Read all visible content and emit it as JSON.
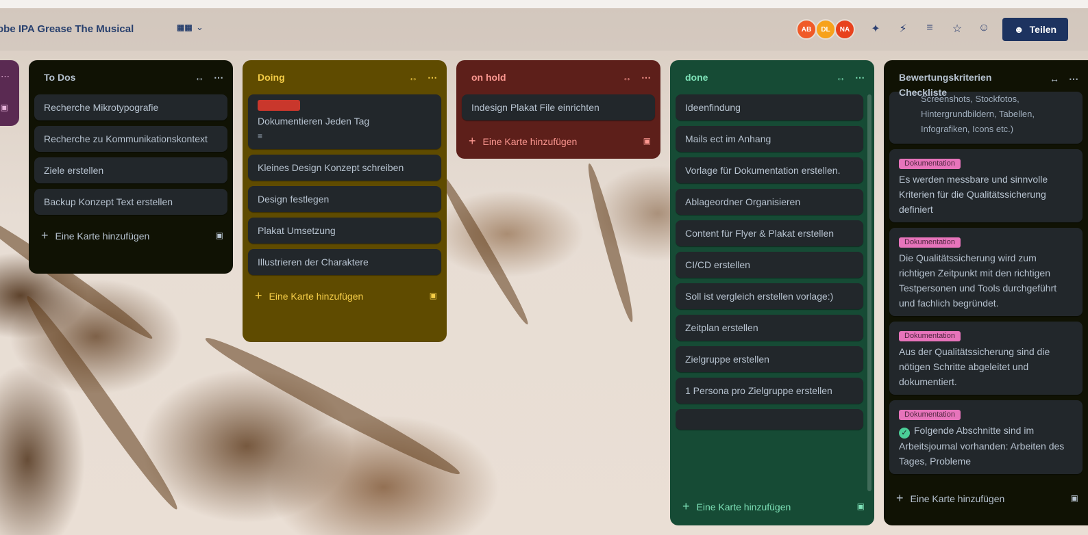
{
  "header": {
    "board_title": "obe IPA Grease The Musical",
    "board_view_icon": "board-icon",
    "share_label": "Teilen",
    "avatars": [
      {
        "initials": "AB",
        "color": "#f05a28"
      },
      {
        "initials": "DL",
        "color": "#f7a21b"
      },
      {
        "initials": "NA",
        "color": "#e8421d"
      }
    ],
    "icons": [
      "pin-icon",
      "lightning-icon",
      "filter-icon",
      "star-icon",
      "people-icon"
    ]
  },
  "colors": {
    "todos": "#101204",
    "doing": "#5f4b00",
    "onhold": "#5d1f1a",
    "done": "#164b35",
    "checklist": "#101204",
    "purple_stub": "#5a2a52",
    "doing_text": "#f5cd47",
    "onhold_text": "#fd9891",
    "done_text": "#7ee2b8",
    "label_pink": "#e774bb",
    "label_red": "#c9372c"
  },
  "lists": {
    "todos": {
      "title": "To Dos",
      "cards": [
        "Recherche Mikrotypografie",
        "Recherche zu Kommunikationskontext",
        "Ziele erstellen",
        "Backup Konzept Text erstellen"
      ],
      "add_label": "Eine Karte hinzufügen"
    },
    "doing": {
      "title": "Doing",
      "cards": [
        "Dokumentieren Jeden Tag",
        "Kleines Design Konzept schreiben",
        "Design festlegen",
        "Plakat Umsetzung",
        "Illustrieren der Charaktere"
      ],
      "add_label": "Eine Karte hinzufügen"
    },
    "onhold": {
      "title": "on hold",
      "cards": [
        "Indesign Plakat File einrichten"
      ],
      "add_label": "Eine Karte hinzufügen"
    },
    "done": {
      "title": "done",
      "cards": [
        "Ideenfindung",
        "Mails ect im Anhang",
        "Vorlage für Dokumentation erstellen.",
        "Ablageordner Organisieren",
        "Content für Flyer & Plakat erstellen",
        "CI/CD erstellen",
        "Soll ist vergleich erstellen vorlage:)",
        "Zeitplan erstellen",
        "Zielgruppe erstellen",
        "1 Persona pro Zielgruppe erstellen"
      ],
      "add_label": "Eine Karte hinzufügen"
    },
    "checklist": {
      "title": "Bewertungskriterien Checkliste",
      "partial_card": "Screenshots, Stockfotos, Hintergrundbildern, Tabellen, Infografiken, Icons etc.)",
      "cards": [
        {
          "label": "Dokumentation",
          "text": "Es werden messbare und sinnvolle Kriterien für die Qualitätssicherung definiert"
        },
        {
          "label": "Dokumentation",
          "text": "Die Qualitätssicherung wird zum richtigen Zeitpunkt mit den richtigen Testpersonen und Tools durchgeführt und fachlich begründet."
        },
        {
          "label": "Dokumentation",
          "text": "Aus der Qualitätssicherung sind die nötigen Schritte abgeleitet und dokumentiert."
        },
        {
          "label": "Dokumentation",
          "text": "Folgende Abschnitte sind im Arbeitsjournal vorhanden: Arbeiten des Tages, Probleme"
        }
      ],
      "add_label": "Eine Karte hinzufügen"
    }
  }
}
